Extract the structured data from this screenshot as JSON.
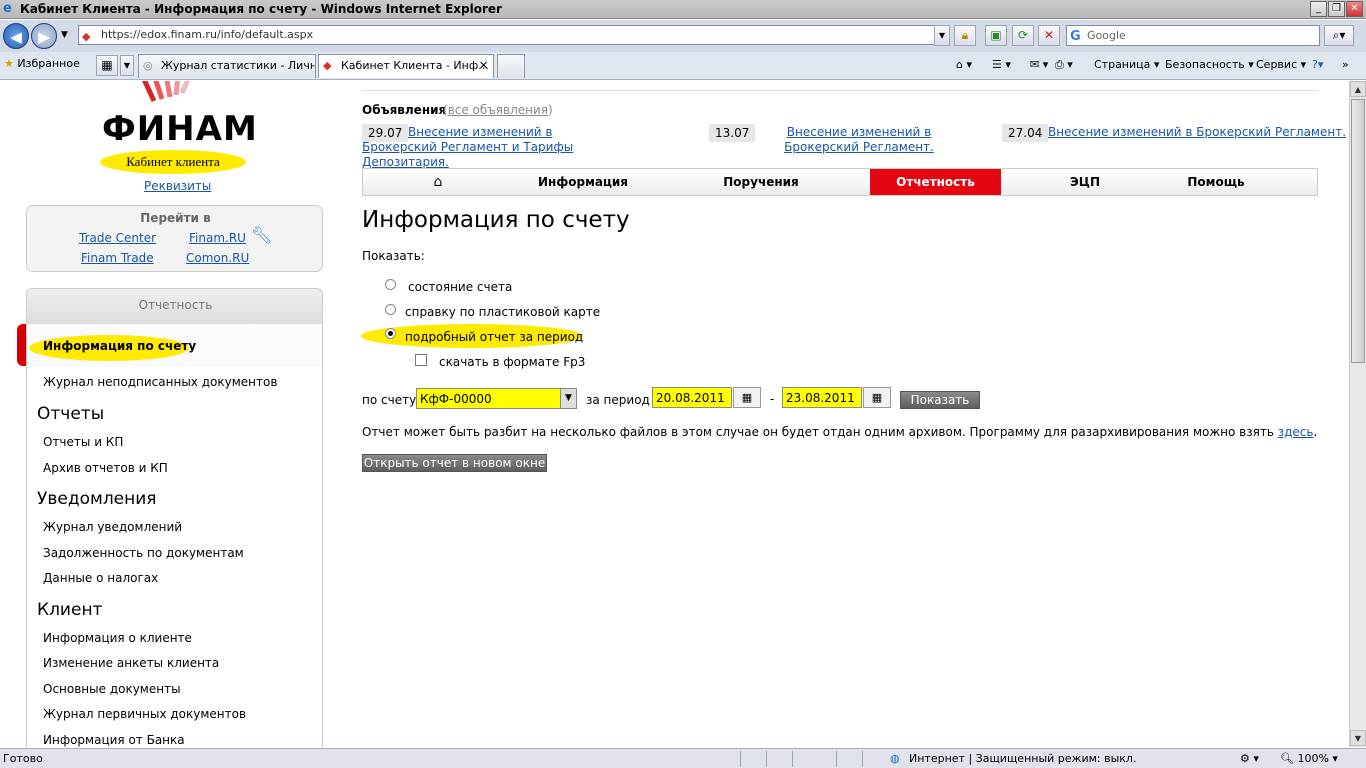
{
  "window": {
    "title": "Кабинет Клиента - Информация по счету - Windows Internet Explorer"
  },
  "browser": {
    "url": "https://edox.finam.ru/info/default.aspx",
    "search_placeholder": "Google",
    "favorites_label": "Избранное",
    "tabs": [
      {
        "label": "Журнал статистики - Личн..."
      },
      {
        "label": "Кабинет Клиента - Инф..."
      }
    ],
    "commands": {
      "page": "Страница",
      "safety": "Безопасность",
      "tools": "Сервис"
    },
    "status": {
      "text": "Готово",
      "zone": "Интернет | Защищенный режим: выкл.",
      "zoom": "100%"
    }
  },
  "sidebar": {
    "logo_text": "ФИНАМ",
    "cabinet_label": "Кабинет клиента",
    "requisites_link": "Реквизиты",
    "goto": {
      "title": "Перейти в",
      "links": [
        "Trade Center",
        "Finam.RU",
        "Finam Trade",
        "Comon.RU"
      ]
    },
    "section_title": "Отчетность",
    "active_item": "Информация по счету",
    "item_unsigned": "Журнал неподписанных документов",
    "groups": [
      {
        "title": "Отчеты",
        "items": [
          "Отчеты и КП",
          "Архив отчетов и КП"
        ]
      },
      {
        "title": "Уведомления",
        "items": [
          "Журнал уведомлений",
          "Задолженность по документам",
          "Данные о налогах"
        ]
      },
      {
        "title": "Клиент",
        "items": [
          "Информация о клиенте",
          "Изменение анкеты клиента",
          "Основные документы",
          "Журнал первичных документов",
          "Информация от Банка"
        ]
      }
    ]
  },
  "announcements": {
    "title": "Объявления",
    "all_link": "все объявления",
    "items": [
      {
        "date": "29.07",
        "text": "Внесение изменений в Брокерский Регламент и Тарифы Депозитария."
      },
      {
        "date": "13.07",
        "text": "Внесение изменений в Брокерский Регламент."
      },
      {
        "date": "27.04",
        "text": "Внесение изменений в Брокерский Регламент."
      }
    ]
  },
  "topnav": {
    "items": [
      "Информация",
      "Поручения",
      "Отчетность",
      "ЭЦП",
      "Помощь"
    ],
    "active": "Отчетность"
  },
  "main": {
    "heading": "Информация по счету",
    "show_label": "Показать:",
    "options": [
      "состояние счета",
      "справку по пластиковой карте",
      "подробный отчет за период"
    ],
    "selected_option": "подробный отчет за период",
    "checkbox_label": "скачать в формате Fp3",
    "account_label": "по счету",
    "account_value": "КфФ-00000",
    "period_label": "за период",
    "date_from": "20.08.2011",
    "date_sep": "-",
    "date_to": "23.08.2011",
    "show_button": "Показать",
    "note_text": "Отчет может быть разбит на несколько файлов в этом случае он будет отдан одним архивом. Программу для разархивирования можно взять ",
    "note_link": "здесь",
    "note_end": ".",
    "open_button": "Открыть отчет в новом окне"
  },
  "colors": {
    "accent": "#e30613",
    "highlight": "#ffea00",
    "link": "#1a55a6"
  }
}
